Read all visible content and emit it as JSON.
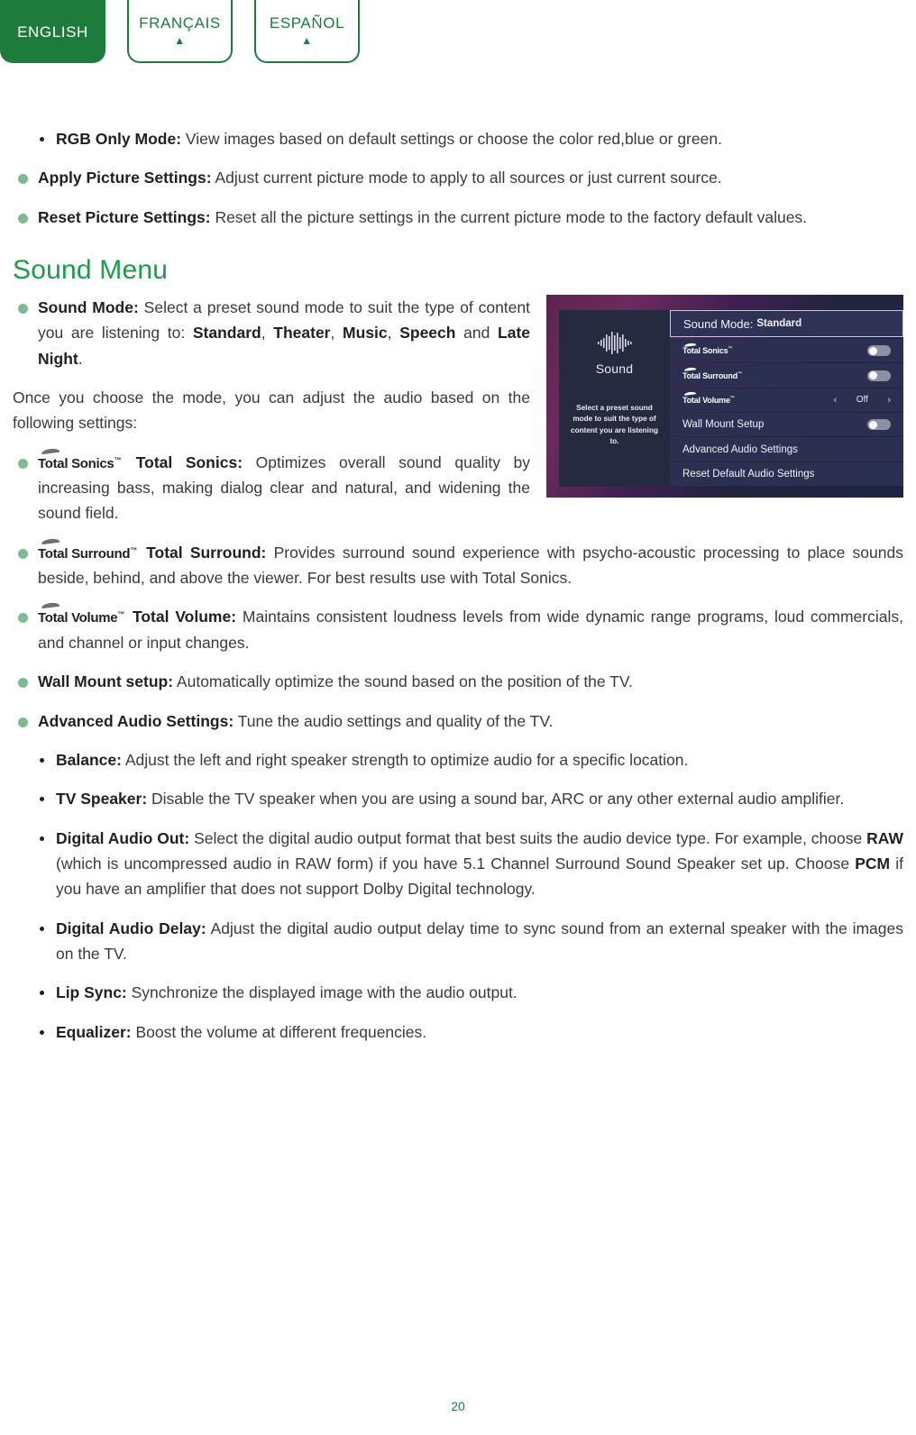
{
  "language_tabs": [
    {
      "label": "ENGLISH",
      "active": true,
      "arrow": ""
    },
    {
      "label": "FRANÇAIS",
      "active": false,
      "arrow": "▲"
    },
    {
      "label": "ESPAÑOL",
      "active": false,
      "arrow": "▲"
    }
  ],
  "colors": {
    "brand_green": "#1d7c3c",
    "heading_green": "#1d9a4a",
    "bullet_green": "#7fba93",
    "body_text": "#3a3a3a"
  },
  "picture_items": [
    {
      "level": 2,
      "term": "RGB Only Mode:",
      "text": " View images based on default settings or choose the color red,blue or green."
    },
    {
      "level": 1,
      "term": "Apply Picture Settings:",
      "text": " Adjust current picture mode to apply to all sources or just current source."
    },
    {
      "level": 1,
      "term": "Reset Picture Settings:",
      "text": " Reset all the picture settings in the current picture mode to the factory default values."
    }
  ],
  "sound_section": {
    "title": "Sound Menu",
    "sound_mode": {
      "term": "Sound Mode:",
      "text_1": " Select a preset sound mode to suit the type of content you are listening to: ",
      "modes": [
        "Standard",
        "Theater",
        "Music",
        "Speech"
      ],
      "conjunction": " and ",
      "last_mode": "Late Night",
      "period": "."
    },
    "intro_paragraph": "Once you choose the mode, you can adjust the audio based on the following settings:",
    "features": [
      {
        "logo": "Total Sonics",
        "logo_tm": "™",
        "term": "Total Sonics:",
        "text": " Optimizes overall sound quality by increasing bass, making dialog clear and natural, and widening the sound field."
      },
      {
        "logo": "Total Surround",
        "logo_tm": "™",
        "term": "Total Surround:",
        "text": " Provides surround sound experience with psycho-acoustic processing to place sounds beside, behind, and above the viewer. For best results use with Total Sonics."
      },
      {
        "logo": "Total Volume",
        "logo_tm": "™",
        "term": "Total Volume:",
        "text": " Maintains consistent loudness levels from wide dynamic range programs, loud commercials, and channel or input changes."
      }
    ],
    "wall_mount": {
      "term": "Wall Mount setup:",
      "text": " Automatically optimize the sound based on the position of the TV."
    },
    "advanced_audio": {
      "term": "Advanced Audio Settings:",
      "text": " Tune the audio settings and quality of the TV."
    },
    "advanced_items": [
      {
        "term": "Balance:",
        "text": " Adjust the left and right speaker strength to optimize audio for a specific location."
      },
      {
        "term": "TV Speaker:",
        "text": " Disable the TV speaker when you are using a sound bar, ARC or any other external audio amplifier."
      },
      {
        "term": "Digital Audio Out:",
        "text_a": " Select the digital audio output format that best suits the audio device type. For example, choose ",
        "bold_a": "RAW",
        "text_b": " (which is uncompressed audio in RAW form) if you have 5.1 Channel Surround Sound Speaker set up. Choose ",
        "bold_b": "PCM",
        "text_c": " if you have an amplifier that does not support Dolby Digital technology."
      },
      {
        "term": "Digital Audio Delay:",
        "text": " Adjust the digital audio output delay time to sync sound from an external speaker with the images on the TV."
      },
      {
        "term": "Lip Sync:",
        "text": " Synchronize the displayed image with the audio output."
      },
      {
        "term": "Equalizer:",
        "text": " Boost the volume at different frequencies."
      }
    ]
  },
  "tv_menu": {
    "sidebar": {
      "icon": "audio-waveform-icon",
      "title": "Sound",
      "description": "Select a preset sound mode to suit the type of content you are listening to."
    },
    "header_row": {
      "label": "Sound Mode:",
      "value": "Standard"
    },
    "rows": [
      {
        "name": "total-sonics",
        "label": "Total Sonics",
        "tm": "™",
        "control": "toggle",
        "state": "off"
      },
      {
        "name": "total-surround",
        "label": "Total Surround",
        "tm": "™",
        "control": "toggle",
        "state": "off"
      },
      {
        "name": "total-volume",
        "label": "Total Volume",
        "tm": "™",
        "control": "stepper",
        "value": "Off",
        "prev": "‹",
        "next": "›"
      },
      {
        "name": "wall-mount-setup",
        "label": "Wall Mount Setup",
        "control": "toggle",
        "state": "off"
      },
      {
        "name": "advanced-audio-settings",
        "label": "Advanced Audio Settings",
        "control": "none"
      },
      {
        "name": "reset-default-audio-settings",
        "label": "Reset Default Audio Settings",
        "control": "none"
      }
    ]
  },
  "footer": {
    "page_number": "20"
  }
}
